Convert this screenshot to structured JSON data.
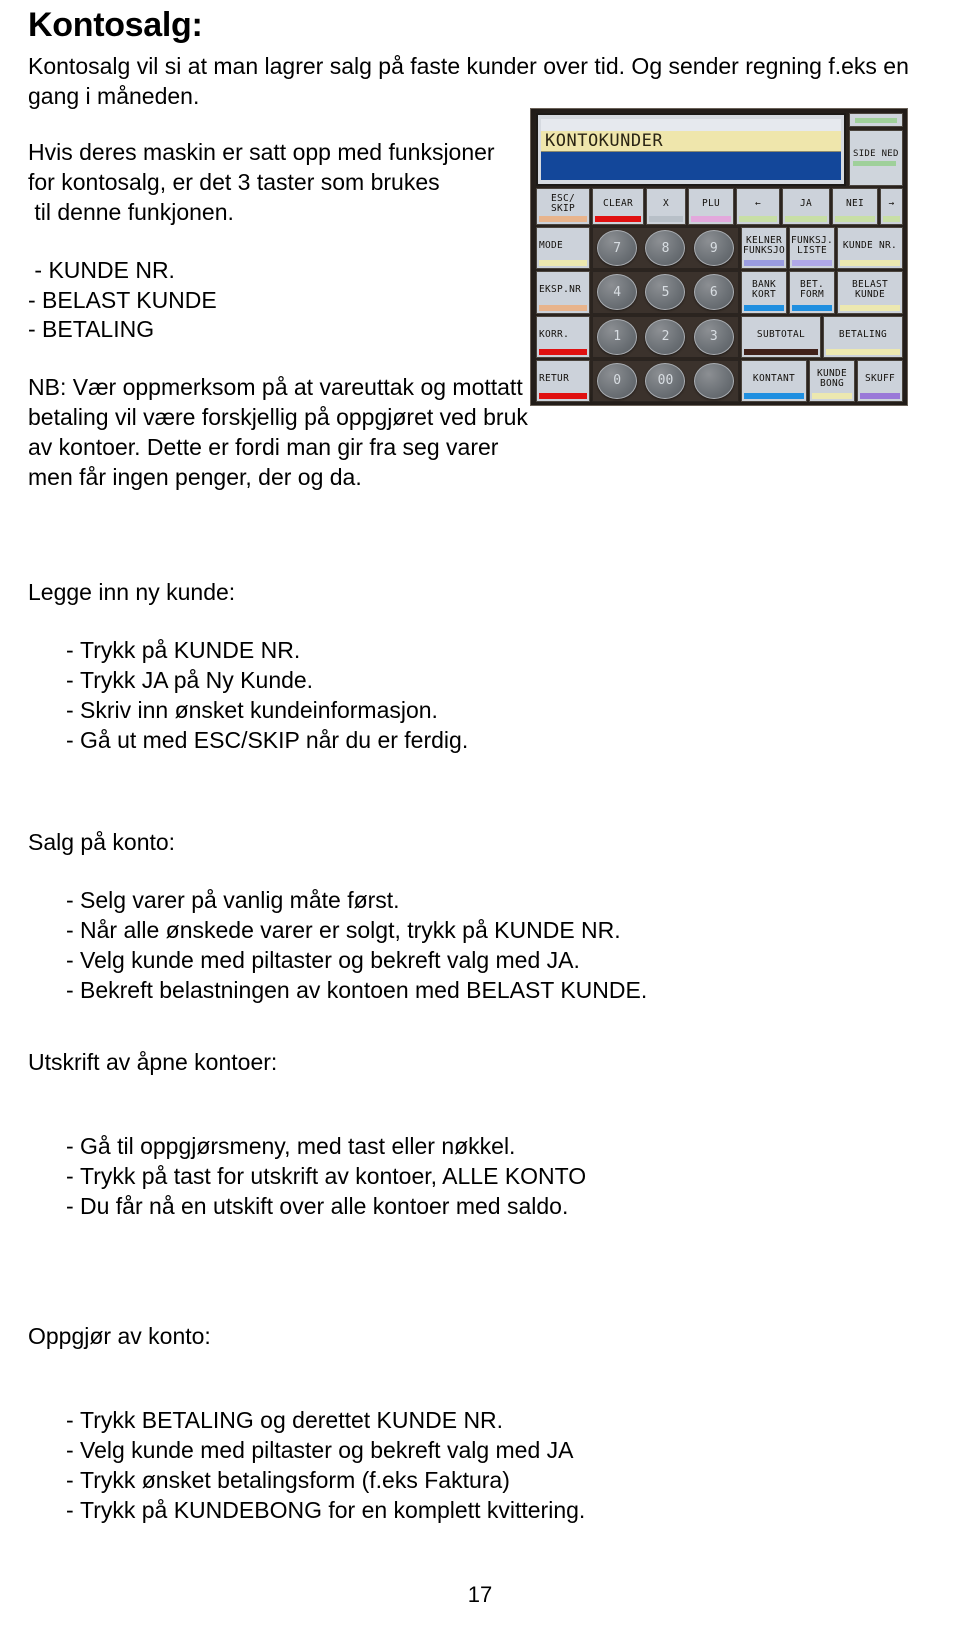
{
  "document": {
    "title": "Kontosalg:",
    "page_number": "17"
  },
  "intro": {
    "line1": "Kontosalg vil si at man lagrer salg på faste kunder over tid. Og sender regning f.eks en",
    "line2": "gang i måneden."
  },
  "left_column": {
    "para1_line1": "Hvis deres maskin er satt opp med funksjoner",
    "para1_line2": "for kontosalg, er det 3 taster som brukes",
    "para1_line3": " til denne funkjonen.",
    "keys": [
      " - KUNDE NR.",
      "- BELAST KUNDE",
      "- BETALING"
    ],
    "nb_line1": "NB: Vær oppmerksom på at vareuttak og mottatt",
    "nb_line2": "betaling vil være forskjellig på oppgjøret ved bruk",
    "nb_line3": "av kontoer. Dette er fordi man gir fra seg varer",
    "nb_line4": "men får ingen penger, der og da."
  },
  "sections": [
    {
      "id": "legge-inn-ny-kunde",
      "heading": "Legge inn ny kunde:",
      "bullet_marker": "-",
      "items": [
        "Trykk på KUNDE NR.",
        "Trykk JA på Ny Kunde.",
        "Skriv inn ønsket kundeinformasjon.",
        "Gå ut med ESC/SKIP når du er ferdig."
      ]
    },
    {
      "id": "salg-pa-konto",
      "heading": "Salg på konto:",
      "bullet_marker": "-",
      "items": [
        "Selg varer på vanlig måte først.",
        "Når alle ønskede varer er solgt, trykk på KUNDE NR.",
        "Velg kunde med piltaster og bekreft valg med JA.",
        "Bekreft belastningen av kontoen med BELAST KUNDE."
      ]
    },
    {
      "id": "utskrift-av-apne-kontoer",
      "heading": "Utskrift av åpne kontoer:",
      "bullet_marker": "-",
      "items": [
        "Gå til oppgjørsmeny, med tast eller nøkkel.",
        "Trykk på tast for utskrift av kontoer, ALLE KONTO",
        "Du får nå en utskift over alle kontoer med saldo."
      ]
    },
    {
      "id": "oppgjor-av-konto",
      "heading": "Oppgjør av konto:",
      "bullet_marker": "-",
      "items": [
        "Trykk BETALING og derettet KUNDE NR.",
        "Velg kunde med piltaster og bekreft valg med JA",
        "Trykk ønsket betalingsform (f.eks Faktura)",
        "Trykk på KUNDEBONG for en komplett kvittering."
      ]
    }
  ],
  "pos_terminal": {
    "screen_title": "KONTOKUNDER",
    "screen_colors": {
      "title_band": "#efe6ac",
      "body_band": "#13479a",
      "bezel": "#2b241f"
    },
    "side_keys": {
      "side_ned": "SIDE\nNED"
    },
    "function_row": [
      {
        "label": "ESC/\nSKIP",
        "led": "#e8b48c"
      },
      {
        "label": "CLEAR",
        "led": "#e01010"
      },
      {
        "label": "X",
        "led": "#b8c0c8"
      },
      {
        "label": "PLU",
        "led": "#e3a8dc"
      },
      {
        "label": "←",
        "led": "#c8dfa6"
      },
      {
        "label": "JA",
        "led": "#c8dfa6"
      },
      {
        "label": "NEI",
        "led": "#c8dfa6"
      },
      {
        "label": "→",
        "led": "#c8dfa6"
      }
    ],
    "left_column_keys": [
      {
        "label": "MODE",
        "led": "#ece8b0"
      },
      {
        "label": "EKSP.NR",
        "led": "#e8b48c"
      },
      {
        "label": "KORR.",
        "led": "#e01010"
      },
      {
        "label": "RETUR",
        "led": "#e01010"
      }
    ],
    "numpad_rows": [
      [
        "7",
        "8",
        "9"
      ],
      [
        "4",
        "5",
        "6"
      ],
      [
        "1",
        "2",
        "3"
      ],
      [
        "0",
        "00",
        ""
      ]
    ],
    "right_keys_row1": [
      {
        "label": "KELNER\nFUNKSJO",
        "led": "#9a9ce0"
      },
      {
        "label": "FUNKSJ.\nLISTE",
        "led": "#b0a8e8"
      },
      {
        "label": "KUNDE NR.",
        "led": "#ece8b0"
      }
    ],
    "right_keys_row2": [
      {
        "label": "BANK\nKORT",
        "led": "#1f8fe0"
      },
      {
        "label": "BET.\nFORM",
        "led": "#1f8fe0"
      },
      {
        "label": "BELAST KUNDE",
        "led": "#ece8b0"
      }
    ],
    "right_keys_row3": [
      {
        "label": "SUBTOTAL",
        "led": "#40211a"
      },
      {
        "label": "BETALING",
        "led": "#ece8b0"
      }
    ],
    "right_keys_row4": [
      {
        "label": "KONTANT",
        "led": "#1f8fe0"
      },
      {
        "label": "KUNDE\nBONG",
        "led": "#ece8b0"
      },
      {
        "label": "SKUFF",
        "led": "#9a78d8"
      }
    ]
  }
}
